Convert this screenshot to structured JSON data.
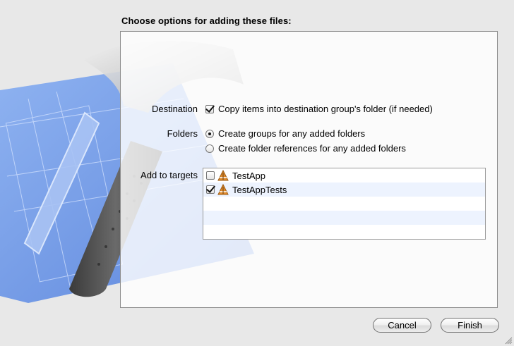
{
  "dialog": {
    "title": "Choose options for adding these files:"
  },
  "options": {
    "destination": {
      "label": "Destination",
      "checkbox_label": "Copy items into destination group's folder (if needed)",
      "checked": true
    },
    "folders": {
      "label": "Folders",
      "choices": [
        {
          "label": "Create groups for any added folders",
          "selected": true
        },
        {
          "label": "Create folder references for any added folders",
          "selected": false
        }
      ]
    },
    "targets": {
      "label": "Add to targets",
      "items": [
        {
          "name": "TestApp",
          "checked": false,
          "icon": "app-icon"
        },
        {
          "name": "TestAppTests",
          "checked": true,
          "icon": "app-icon"
        }
      ]
    }
  },
  "buttons": {
    "cancel": "Cancel",
    "finish": "Finish"
  },
  "colors": {
    "blueprint": "#6f9ae8",
    "list_stripe": "#edf3fe",
    "icon_orange": "#e08a2b"
  }
}
